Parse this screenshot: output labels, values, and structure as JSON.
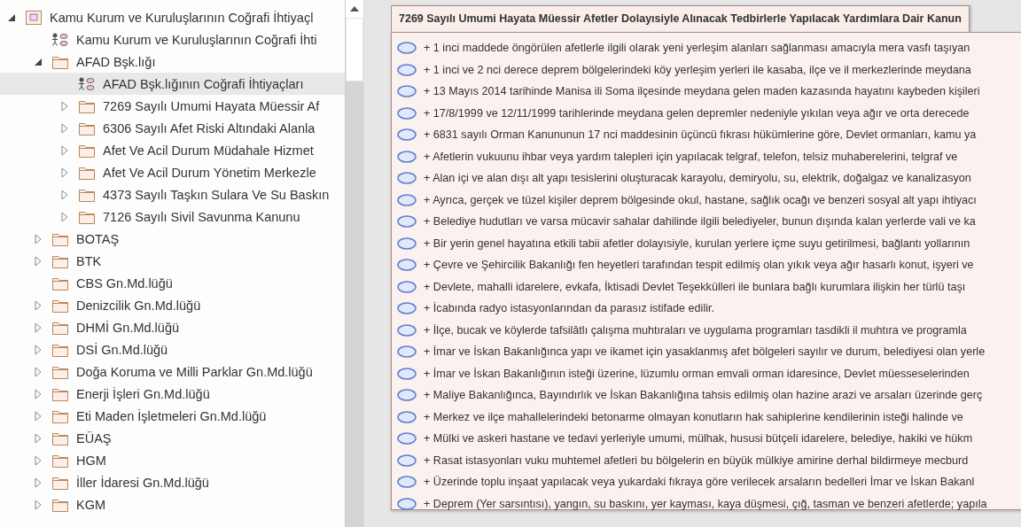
{
  "tree": {
    "items": [
      {
        "label": "Kamu Kurum ve Kuruluşlarının Coğrafi İhtiyaçl",
        "kind": "package",
        "expanded": true,
        "selected": false,
        "children": [
          {
            "label": "Kamu Kurum ve Kuruluşlarının Coğrafi İhti",
            "kind": "usecase",
            "selected": false
          },
          {
            "label": "AFAD Bşk.lığı",
            "kind": "folder",
            "expanded": true,
            "selected": false,
            "children": [
              {
                "label": "AFAD Bşk.lığının Coğrafi İhtiyaçları",
                "kind": "usecase",
                "selected": true
              },
              {
                "label": "7269 Sayılı Umumi Hayata Müessir Af",
                "kind": "folder",
                "expanded": false,
                "selected": false
              },
              {
                "label": "6306 Sayılı Afet Riski Altındaki Alanla",
                "kind": "folder",
                "expanded": false,
                "selected": false
              },
              {
                "label": "Afet Ve Acil Durum Müdahale Hizmet",
                "kind": "folder",
                "expanded": false,
                "selected": false
              },
              {
                "label": "Afet Ve Acil Durum Yönetim Merkezle",
                "kind": "folder",
                "expanded": false,
                "selected": false
              },
              {
                "label": "4373 Sayılı Taşkın Sulara Ve Su Baskın",
                "kind": "folder",
                "expanded": false,
                "selected": false
              },
              {
                "label": "7126 Sayılı Sivil Savunma Kanunu",
                "kind": "folder",
                "expanded": false,
                "selected": false
              }
            ]
          },
          {
            "label": "BOTAŞ",
            "kind": "folder",
            "expanded": false,
            "selected": false
          },
          {
            "label": "BTK",
            "kind": "folder",
            "expanded": false,
            "selected": false
          },
          {
            "label": "CBS Gn.Md.lüğü",
            "kind": "folder",
            "selected": false
          },
          {
            "label": "Denizcilik Gn.Md.lüğü",
            "kind": "folder",
            "expanded": false,
            "selected": false
          },
          {
            "label": "DHMİ Gn.Md.lüğü",
            "kind": "folder",
            "expanded": false,
            "selected": false
          },
          {
            "label": "DSİ Gn.Md.lüğü",
            "kind": "folder",
            "expanded": false,
            "selected": false
          },
          {
            "label": "Doğa Koruma ve Milli Parklar Gn.Md.lüğü",
            "kind": "folder",
            "expanded": false,
            "selected": false
          },
          {
            "label": "Enerji İşleri Gn.Md.lüğü",
            "kind": "folder",
            "expanded": false,
            "selected": false
          },
          {
            "label": "Eti Maden İşletmeleri Gn.Md.lüğü",
            "kind": "folder",
            "expanded": false,
            "selected": false
          },
          {
            "label": "EÜAŞ",
            "kind": "folder",
            "expanded": false,
            "selected": false
          },
          {
            "label": "HGM",
            "kind": "folder",
            "expanded": false,
            "selected": false
          },
          {
            "label": "İller İdaresi Gn.Md.lüğü",
            "kind": "folder",
            "expanded": false,
            "selected": false
          },
          {
            "label": "KGM",
            "kind": "folder",
            "expanded": false,
            "selected": false
          }
        ]
      }
    ]
  },
  "diagram": {
    "title": "7269 Sayılı Umumi Hayata Müessir Afetler Dolayısiyle Alınacak Tedbirlerle Yapılacak Yardımlara Dair Kanun",
    "use_cases": [
      "+ 1 inci maddede öngörülen afetlerle ilgili olarak yeni yerleşim alanları sağlanması amacıyla mera vasfı taşıyan",
      "+ 1 inci ve 2 nci derece deprem bölgelerindeki köy yerleşim yerleri ile kasaba, ilçe ve il merkezlerinde meydana",
      "+ 13 Mayıs 2014 tarihinde Manisa ili Soma ilçesinde meydana gelen maden kazasında hayatını kaybeden kişileri",
      "+ 17/8/1999 ve 12/11/1999 tarihlerinde meydana gelen depremler nedeniyle yıkılan veya ağır ve orta derecede",
      "+ 6831 sayılı Orman Kanununun 17 nci maddesinin üçüncü fıkrası hükümlerine göre, Devlet ormanları, kamu ya",
      "+ Afetlerin vukuunu ihbar veya yardım talepleri için yapılacak telgraf, telefon, telsiz muhaberelerini, telgraf ve",
      "+ Alan içi ve alan dışı alt yapı tesislerini oluşturacak karayolu, demiryolu, su, elektrik, doğalgaz ve kanalizasyon",
      "+ Ayrıca, gerçek ve tüzel kişiler deprem bölgesinde okul, hastane, sağlık ocağı ve benzeri sosyal alt yapı ihtiyacı",
      "+ Belediye hudutları ve varsa mücavir sahalar dahilinde ilgili belediyeler, bunun dışında kalan yerlerde vali ve ka",
      "+ Bir yerin genel hayatına etkili tabii afetler dolayısiyle, kurulan yerlere içme suyu getirilmesi, bağlantı yollarının",
      "+ Çevre ve Şehircilik Bakanlığı fen heyetleri tarafından tespit edilmiş olan yıkık veya ağır hasarlı konut, işyeri ve",
      "+ Devlete, mahalli idarelere, evkafa, İktisadi Devlet Teşekkülleri ile bunlara bağlı kurumlara ilişkin her türlü taşı",
      "+ İcabında radyo istasyonlarından da parasız istifade edilir.",
      "+ İlçe, bucak ve köylerde tafsilâtlı çalışma muhtıraları ve uygulama programları tasdikli il muhtıra ve programla",
      "+ İmar ve İskan Bakanlığınca yapı ve ikamet için yasaklanmış afet bölgeleri sayılır ve durum, belediyesi olan yerle",
      "+ İmar ve İskan Bakanlığının isteği üzerine, lüzumlu orman emvali orman idaresince, Devlet müesseselerinden",
      "+ Maliye Bakanlığınca, Bayındırlık ve İskan Bakanlığına tahsis edilmiş olan hazine arazi ve arsaları üzerinde gerç",
      "+ Merkez ve ilçe mahallelerindeki betonarme olmayan konutların hak sahiplerine kendilerinin isteği halinde ve",
      "+ Mülki ve askeri hastane ve tedavi yerleriyle umumi, mülhak, hususi bütçeli idarelere, belediye, hakiki ve hükm",
      "+ Rasat istasyonları vuku muhtemel afetleri bu bölgelerin en büyük mülkiye amirine derhal bildirmeye mecburd",
      "+ Üzerinde toplu inşaat yapılacak veya yukardaki fıkraya göre verilecek arsaların bedelleri İmar ve İskan Bakanl",
      "+ Deprem (Yer sarsıntısı), yangın, su baskını, yer kayması, kaya düşmesi, çığ, tasman ve benzeri afetlerde; yapıla"
    ]
  }
}
